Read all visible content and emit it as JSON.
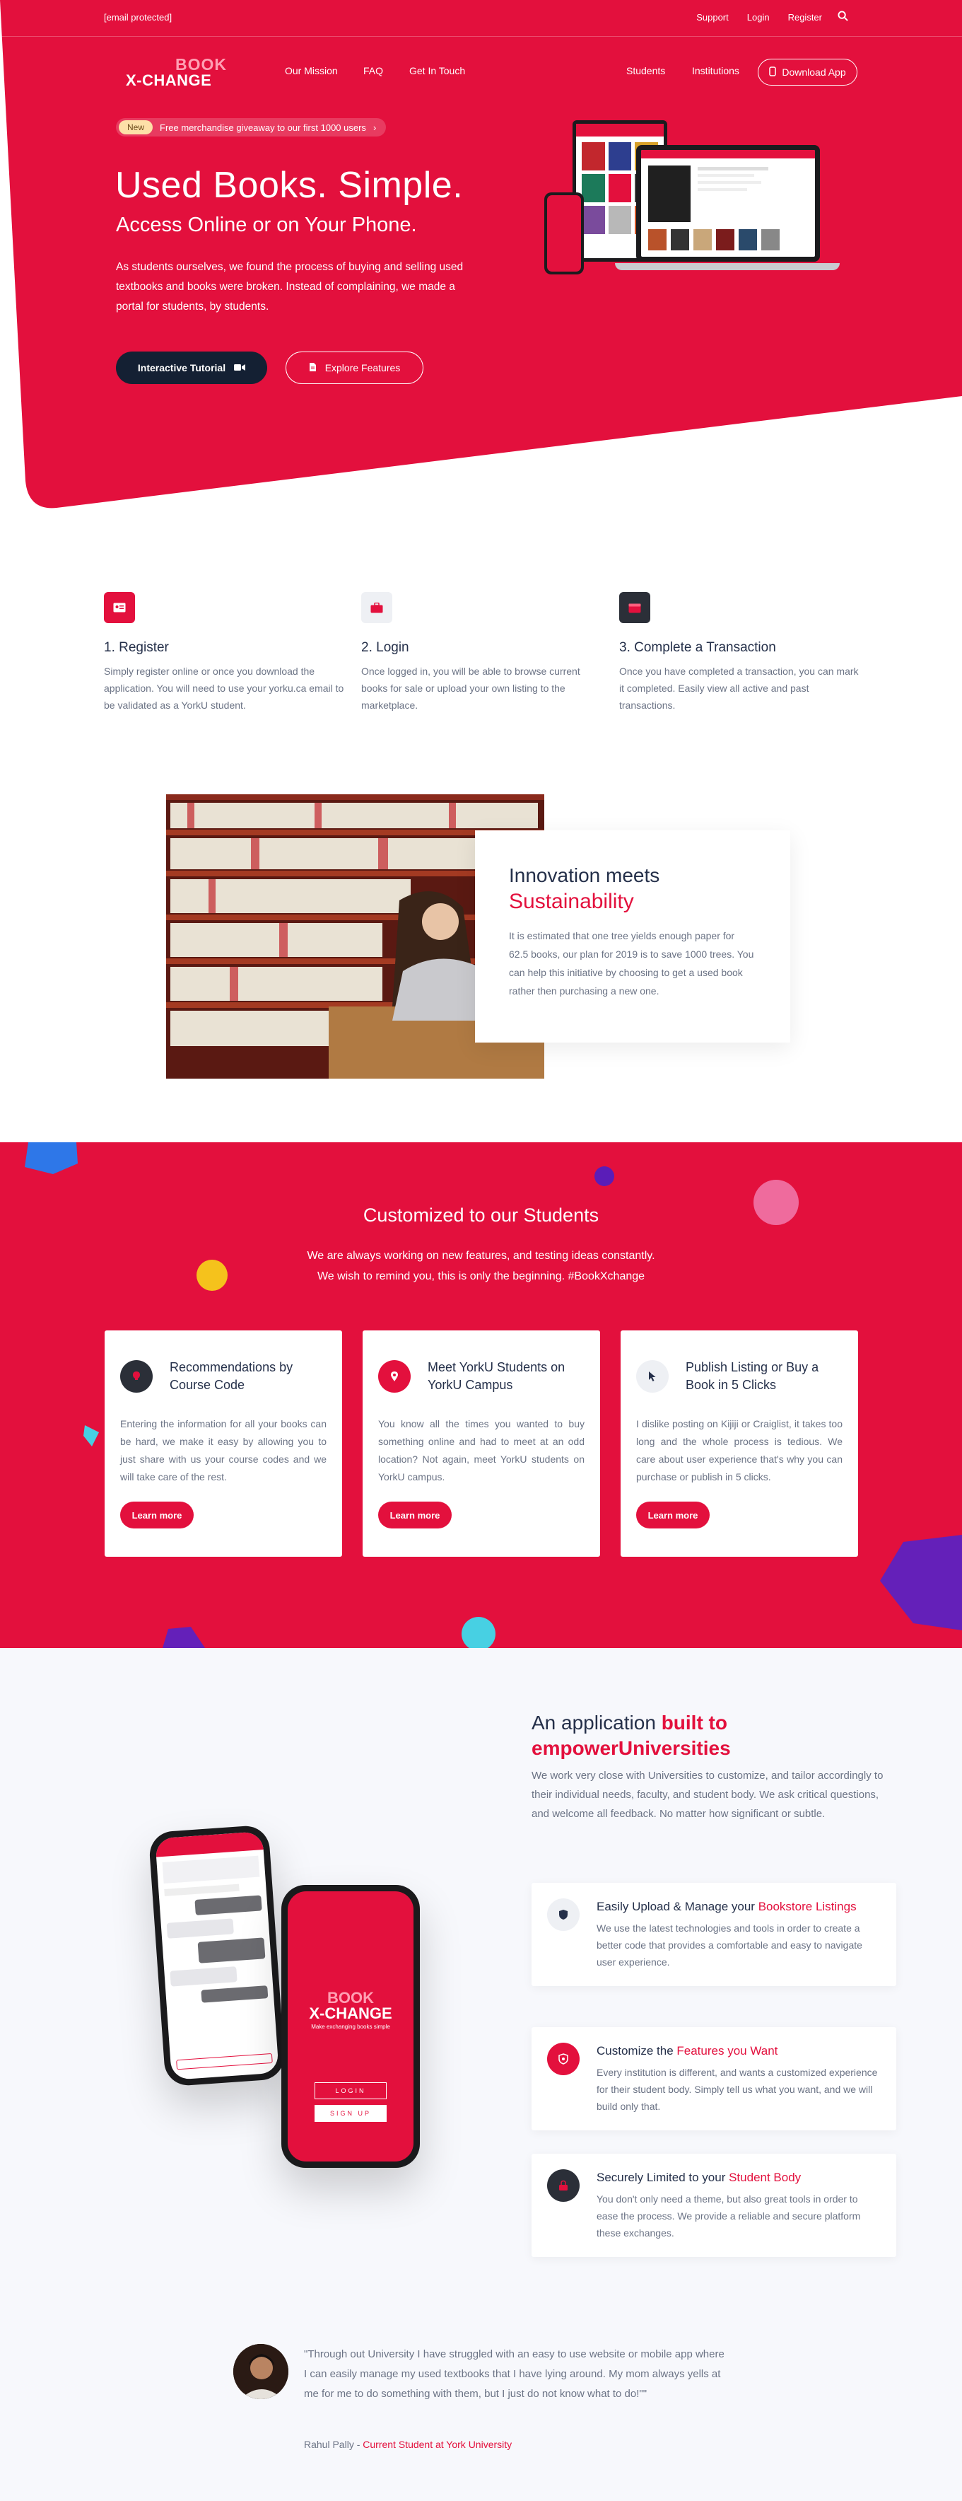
{
  "topbar": {
    "email": "[email protected]",
    "links": [
      "Support",
      "Login",
      "Register"
    ]
  },
  "logo": {
    "line1": "BOOK",
    "line2": "X-CHANGE"
  },
  "nav": {
    "left": [
      "Our Mission",
      "FAQ",
      "Get In Touch"
    ],
    "right": [
      "Students",
      "Institutions"
    ],
    "download": "Download App"
  },
  "hero": {
    "badge": "New",
    "promo": "Free merchandise giveaway to our first 1000 users",
    "title": "Used Books. Simple.",
    "subtitle": "Access Online or on Your Phone.",
    "paragraph": "As students ourselves, we found the process of buying and selling used textbooks and books were broken. Instead of complaining, we made a portal for students, by students.",
    "btn_tutorial": "Interactive Tutorial",
    "btn_explore": "Explore Features"
  },
  "steps": [
    {
      "title": "1. Register",
      "text": "Simply register online or once you download the application. You will need to use your yorku.ca email to be validated as a YorkU student."
    },
    {
      "title": "2. Login",
      "text": "Once logged in, you will be able to browse current books for sale or upload your own listing to the marketplace."
    },
    {
      "title": "3. Complete a Transaction",
      "text": "Once you have completed a transaction, you can mark it completed. Easily view all active and past transactions."
    }
  ],
  "innovation": {
    "title": "Innovation meets",
    "accent": "Sustainability",
    "text": "It is estimated that one tree yields enough paper for 62.5 books, our plan for 2019 is to save 1000 trees. You can help this initiative by choosing to get a used book rather then purchasing a new one."
  },
  "features": {
    "title": "Customized to our Students",
    "line1": "We are always working on new features, and testing ideas constantly.",
    "line2": "We wish to remind you, this is only the beginning. #BookXchange",
    "cards": [
      {
        "title": "Recommendations by Course Code",
        "text": "Entering the information for all your books can be hard, we make it easy by allowing you to just share with us your course codes and we will take care of the rest.",
        "button": "Learn more"
      },
      {
        "title": "Meet YorkU Students on YorkU Campus",
        "text": "You know all the times you wanted to buy something online and had to meet at an odd location? Not again, meet YorkU students on YorkU campus.",
        "button": "Learn more"
      },
      {
        "title": "Publish Listing or Buy a Book in 5 Clicks",
        "text": "I dislike posting on Kijiji or Craiglist, it takes too long and the whole process is tedious. We care about user experience that's why you can purchase or publish in 5 clicks.",
        "button": "Learn more"
      }
    ]
  },
  "app": {
    "heading_prefix": "An application ",
    "heading_accent1": "built to",
    "heading_accent2": "empowerUniversities",
    "paragraph": "We work very close with Universities to customize, and tailor accordingly to their individual needs, faculty, and student body. We ask critical questions, and welcome all feedback. No matter how significant or subtle.",
    "cards": [
      {
        "title": "Easily Upload & Manage your ",
        "accent": "Bookstore Listings",
        "text": "We use the latest technologies and tools in order to create a better code that provides a comfortable and easy to navigate user experience."
      },
      {
        "title": "Customize the ",
        "accent": "Features you Want",
        "text": "Every institution is different, and wants a customized experience for their student body. Simply tell us what you want, and we will build only that."
      },
      {
        "title": "Securely Limited to your ",
        "accent": "Student Body",
        "text": "You don't only need a theme, but also great tools in order to ease the process. We provide a reliable and secure platform these exchanges."
      }
    ],
    "phone_login": "LOGIN",
    "phone_signup": "SIGN UP",
    "phone_tag": "Make exchanging books simple"
  },
  "testimonial": {
    "quote": "\"Through out University I have struggled with an easy to use website or mobile app where I can easily manage my used textbooks that I have lying around. My mom always yells at me for me to do something with them, but I just do not know what to do!\"\"",
    "author": "Rahul Pally - ",
    "role": "Current Student at York University"
  },
  "colors": {
    "brand": "#e3103d",
    "dark": "#142033",
    "bg_light": "#f7f8fc"
  }
}
